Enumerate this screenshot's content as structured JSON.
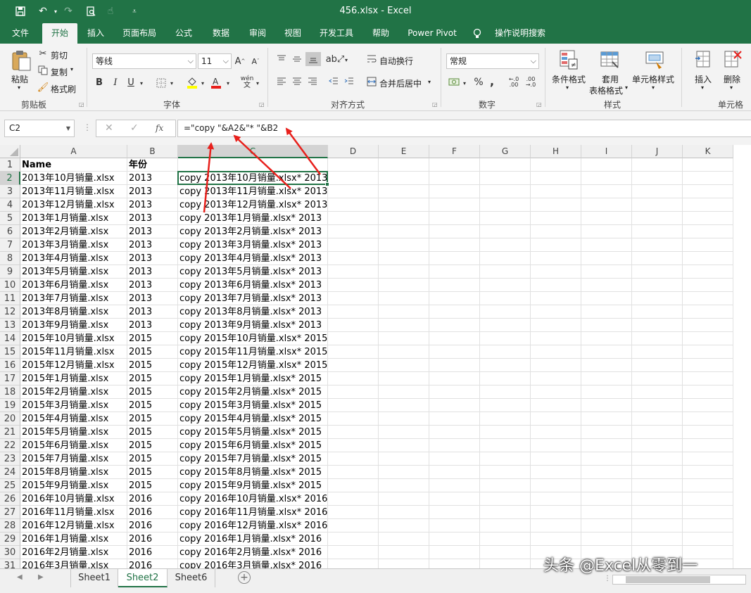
{
  "titlebar": {
    "title": "456.xlsx  -  Excel",
    "qat": [
      "save-icon",
      "undo-icon",
      "redo-icon",
      "print-preview-icon",
      "touch-mode-icon",
      "customize-icon"
    ]
  },
  "tabs": [
    "文件",
    "开始",
    "插入",
    "页面布局",
    "公式",
    "数据",
    "审阅",
    "视图",
    "开发工具",
    "帮助",
    "Power Pivot",
    "操作说明搜索"
  ],
  "active_tab": "开始",
  "ribbon": {
    "clipboard": {
      "paste": "粘贴",
      "cut": "剪切",
      "copy": "复制",
      "format_painter": "格式刷",
      "label": "剪贴板"
    },
    "font": {
      "name": "等线",
      "size": "11",
      "bold": "B",
      "italic": "I",
      "underline": "U",
      "phonetic": "wén",
      "label": "字体"
    },
    "alignment": {
      "wrap_text": "自动换行",
      "merge_center": "合并后居中",
      "label": "对齐方式"
    },
    "number": {
      "format": "常规",
      "percent": "%",
      "comma": ",",
      "label": "数字"
    },
    "styles": {
      "conditional": "条件格式",
      "table_format_1": "套用",
      "table_format_2": "表格格式",
      "cell_styles": "单元格样式",
      "label": "样式"
    },
    "cells": {
      "insert": "插入",
      "delete": "删除",
      "label": "单元格"
    }
  },
  "formula_bar": {
    "name_box": "C2",
    "fx": "fx",
    "formula": "=\"copy \"&A2&\"* \"&B2"
  },
  "columns": [
    "A",
    "B",
    "C",
    "D",
    "E",
    "F",
    "G",
    "H",
    "I",
    "J",
    "K"
  ],
  "rows": [
    {
      "n": "1",
      "a": "Name",
      "b": "年份",
      "c": ""
    },
    {
      "n": "2",
      "a": "2013年10月销量.xlsx",
      "b": "2013",
      "c": "copy 2013年10月销量.xlsx* 2013"
    },
    {
      "n": "3",
      "a": "2013年11月销量.xlsx",
      "b": "2013",
      "c": "copy 2013年11月销量.xlsx* 2013"
    },
    {
      "n": "4",
      "a": "2013年12月销量.xlsx",
      "b": "2013",
      "c": "copy 2013年12月销量.xlsx* 2013"
    },
    {
      "n": "5",
      "a": "2013年1月销量.xlsx",
      "b": "2013",
      "c": "copy 2013年1月销量.xlsx* 2013"
    },
    {
      "n": "6",
      "a": "2013年2月销量.xlsx",
      "b": "2013",
      "c": "copy 2013年2月销量.xlsx* 2013"
    },
    {
      "n": "7",
      "a": "2013年3月销量.xlsx",
      "b": "2013",
      "c": "copy 2013年3月销量.xlsx* 2013"
    },
    {
      "n": "8",
      "a": "2013年4月销量.xlsx",
      "b": "2013",
      "c": "copy 2013年4月销量.xlsx* 2013"
    },
    {
      "n": "9",
      "a": "2013年5月销量.xlsx",
      "b": "2013",
      "c": "copy 2013年5月销量.xlsx* 2013"
    },
    {
      "n": "10",
      "a": "2013年6月销量.xlsx",
      "b": "2013",
      "c": "copy 2013年6月销量.xlsx* 2013"
    },
    {
      "n": "11",
      "a": "2013年7月销量.xlsx",
      "b": "2013",
      "c": "copy 2013年7月销量.xlsx* 2013"
    },
    {
      "n": "12",
      "a": "2013年8月销量.xlsx",
      "b": "2013",
      "c": "copy 2013年8月销量.xlsx* 2013"
    },
    {
      "n": "13",
      "a": "2013年9月销量.xlsx",
      "b": "2013",
      "c": "copy 2013年9月销量.xlsx* 2013"
    },
    {
      "n": "14",
      "a": "2015年10月销量.xlsx",
      "b": "2015",
      "c": "copy 2015年10月销量.xlsx* 2015"
    },
    {
      "n": "15",
      "a": "2015年11月销量.xlsx",
      "b": "2015",
      "c": "copy 2015年11月销量.xlsx* 2015"
    },
    {
      "n": "16",
      "a": "2015年12月销量.xlsx",
      "b": "2015",
      "c": "copy 2015年12月销量.xlsx* 2015"
    },
    {
      "n": "17",
      "a": "2015年1月销量.xlsx",
      "b": "2015",
      "c": "copy 2015年1月销量.xlsx* 2015"
    },
    {
      "n": "18",
      "a": "2015年2月销量.xlsx",
      "b": "2015",
      "c": "copy 2015年2月销量.xlsx* 2015"
    },
    {
      "n": "19",
      "a": "2015年3月销量.xlsx",
      "b": "2015",
      "c": "copy 2015年3月销量.xlsx* 2015"
    },
    {
      "n": "20",
      "a": "2015年4月销量.xlsx",
      "b": "2015",
      "c": "copy 2015年4月销量.xlsx* 2015"
    },
    {
      "n": "21",
      "a": "2015年5月销量.xlsx",
      "b": "2015",
      "c": "copy 2015年5月销量.xlsx* 2015"
    },
    {
      "n": "22",
      "a": "2015年6月销量.xlsx",
      "b": "2015",
      "c": "copy 2015年6月销量.xlsx* 2015"
    },
    {
      "n": "23",
      "a": "2015年7月销量.xlsx",
      "b": "2015",
      "c": "copy 2015年7月销量.xlsx* 2015"
    },
    {
      "n": "24",
      "a": "2015年8月销量.xlsx",
      "b": "2015",
      "c": "copy 2015年8月销量.xlsx* 2015"
    },
    {
      "n": "25",
      "a": "2015年9月销量.xlsx",
      "b": "2015",
      "c": "copy 2015年9月销量.xlsx* 2015"
    },
    {
      "n": "26",
      "a": "2016年10月销量.xlsx",
      "b": "2016",
      "c": "copy 2016年10月销量.xlsx* 2016"
    },
    {
      "n": "27",
      "a": "2016年11月销量.xlsx",
      "b": "2016",
      "c": "copy 2016年11月销量.xlsx* 2016"
    },
    {
      "n": "28",
      "a": "2016年12月销量.xlsx",
      "b": "2016",
      "c": "copy 2016年12月销量.xlsx* 2016"
    },
    {
      "n": "29",
      "a": "2016年1月销量.xlsx",
      "b": "2016",
      "c": "copy 2016年1月销量.xlsx* 2016"
    },
    {
      "n": "30",
      "a": "2016年2月销量.xlsx",
      "b": "2016",
      "c": "copy 2016年2月销量.xlsx* 2016"
    },
    {
      "n": "31",
      "a": "2016年3月销量.xlsx",
      "b": "2016",
      "c": "copy 2016年3月销量.xlsx* 2016"
    }
  ],
  "sheets": [
    "Sheet1",
    "Sheet2",
    "Sheet6"
  ],
  "active_sheet": "Sheet2",
  "watermark": "头条 @Excel从零到一",
  "colors": {
    "excel_green": "#217346",
    "arrow_red": "#e8201c"
  }
}
